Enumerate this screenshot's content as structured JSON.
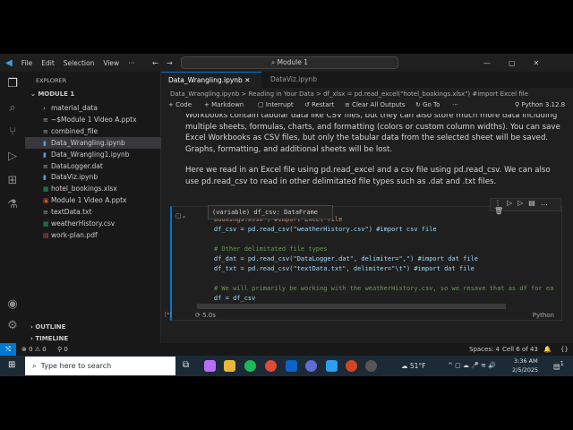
{
  "titlebar": {
    "menus": [
      "File",
      "Edit",
      "Selection",
      "View",
      "···"
    ],
    "search": "Module 1"
  },
  "sidebar": {
    "title": "EXPLORER",
    "folder": "MODULE 1",
    "files": [
      {
        "name": "material_data",
        "icon": "chevron-right"
      },
      {
        "name": "~$Module 1 Video A.pptx",
        "icon": "file"
      },
      {
        "name": "combined_file",
        "icon": "file"
      },
      {
        "name": "Data_Wrangling.ipynb",
        "icon": "notebook",
        "selected": true
      },
      {
        "name": "Data_Wrangling1.ipynb",
        "icon": "notebook"
      },
      {
        "name": "DataLogger.dat",
        "icon": "file"
      },
      {
        "name": "DataViz.ipynb",
        "icon": "notebook"
      },
      {
        "name": "hotel_bookings.xlsx",
        "icon": "excel"
      },
      {
        "name": "Module 1 Video A.pptx",
        "icon": "powerpoint"
      },
      {
        "name": "textData.txt",
        "icon": "file"
      },
      {
        "name": "weatherHistory.csv",
        "icon": "csv"
      },
      {
        "name": "work-plan.pdf",
        "icon": "pdf"
      }
    ],
    "outline": "OUTLINE",
    "timeline": "TIMELINE"
  },
  "tabs": [
    "Data_Wrangling.ipynb",
    "DataViz.ipynb"
  ],
  "breadcrumb": [
    "Data_Wrangling.ipynb",
    ">",
    "Reading in Your Data",
    ">",
    "df_xlsx = pd.read_excel(\"hotel_bookings.xlsx\") #import Excel file"
  ],
  "toolbar": {
    "code": "+ Code",
    "markdown": "+ Markdown",
    "interrupt": "Interrupt",
    "restart": "Restart",
    "clear": "Clear All Outputs",
    "goto": "Go To",
    "more": "···",
    "kernel": "Python 3.12.8"
  },
  "markdown": {
    "p1": "Workbooks contain tabular data like CSV files, but they can also store much more data including multiple sheets, formulas, charts, and formatting (colors or custom column widths). You can save Excel Workbooks as CSV files, but only the tabular data from the selected sheet will be saved. Graphs, formatting, and additional sheets will be lost.",
    "p2": "Here we read in an Excel file using pd.read_excel and a csv file using pd.read_csv. We can also use pd.read_csv to read in other delimitated file types such as .dat and .txt files."
  },
  "cell": {
    "tooltip": "(variable) df_csv: DataFrame",
    "lines": [
      "bookings.xlsx\") #import Excel file",
      "df_csv = pd.read_csv(\"weatherHistory.csv\") #import csv file",
      "# Other delimitated file types",
      "df_dat = pd.read_csv(\"DataLogger.dat\", delimiter=\",\") #import dat file",
      "df_txt = pd.read_csv(\"textData.txt\", delimiter=\"\\t\") #import dat file",
      "# We will primarily be working with the weatherHistory.csv, so we resave that as df for ea",
      "df = df_csv"
    ],
    "exec": "[*]",
    "time": "5.0s",
    "lang": "Python"
  },
  "status": {
    "errors": "0",
    "warnings": "0",
    "ports": "0",
    "spaces": "Spaces: 4",
    "cell": "Cell 6 of 43"
  },
  "taskbar": {
    "search": "Type here to search",
    "weather": "51°F",
    "time": "3:36 AM",
    "date": "2/5/2025",
    "notif": "1"
  }
}
